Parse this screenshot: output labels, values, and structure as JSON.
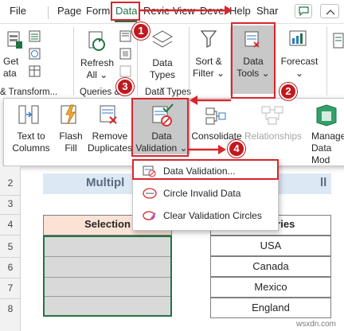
{
  "tabs": [
    "File",
    "Page",
    "Form",
    "Data",
    "Revie",
    "View",
    "Deve",
    "Help",
    "Shar"
  ],
  "ribbon": {
    "get_data_label": "Get",
    "get_data_label2": "ata",
    "refresh_label": "Refresh",
    "refresh_label2": "All",
    "data_types_label": "Data",
    "data_types_label2": "Types",
    "sort_filter_label": "Sort &",
    "sort_filter_label2": "Filter",
    "data_tools_label": "Data",
    "data_tools_label2": "Tools",
    "forecast_label": "Forecast",
    "group_transform": "& Transform...",
    "group_queries": "Queries &...",
    "group_datatypes": "Data Types"
  },
  "flyout": {
    "text_to_columns": "Text to",
    "text_to_columns2": "Columns",
    "flash_fill": "Flash",
    "flash_fill2": "Fill",
    "remove_duplicates": "Remove",
    "remove_duplicates2": "Duplicates",
    "data_validation": "Data",
    "data_validation2": "Validation",
    "consolidate": "Consolidate",
    "relationships": "Relationships",
    "manage": "Manage",
    "manage2": "Data Mod"
  },
  "menu": {
    "data_validation": "Data Validation...",
    "circle_invalid": "Circle Invalid Data",
    "clear_circles": "Clear Validation Circles"
  },
  "sheet": {
    "title_fragment_left": "Multipl",
    "title_fragment_right": "ll",
    "selection_header": "Selection",
    "countries_header": "Countries",
    "countries": [
      "USA",
      "Canada",
      "Mexico",
      "England"
    ],
    "rows": [
      "2",
      "3",
      "4",
      "5",
      "6",
      "7",
      "8"
    ]
  },
  "badges": [
    "1",
    "2",
    "3",
    "4"
  ],
  "watermark": "wsxdn.com",
  "colors": {
    "accent": "#217346",
    "annotation_red": "#d9262c",
    "title_band": "#dde8f5",
    "selection_header_fill": "#fbe2d5",
    "selected_cells": "#d9d9d9"
  }
}
